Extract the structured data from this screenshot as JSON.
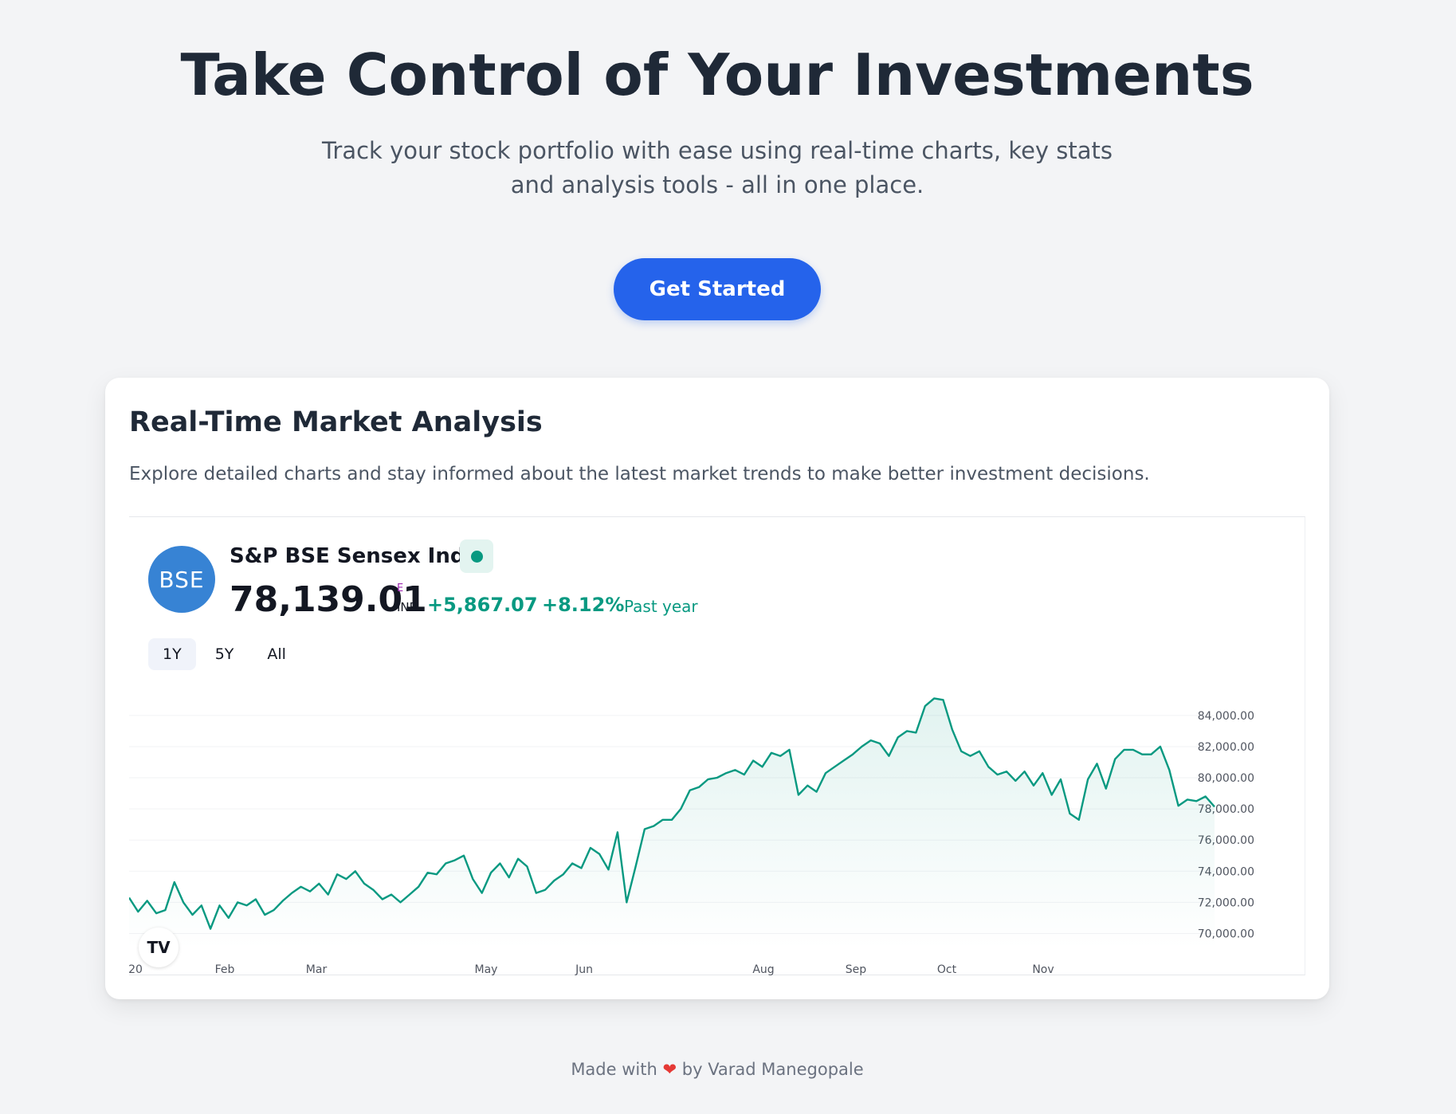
{
  "hero": {
    "title": "Take Control of Your Investments",
    "subtitle": "Track your stock portfolio with ease using real-time charts, key stats and analysis tools - all in one place.",
    "cta_label": "Get Started"
  },
  "card": {
    "title": "Real-Time Market Analysis",
    "description": "Explore detailed charts and stay informed about the latest market trends to make better investment decisions."
  },
  "widget": {
    "logo_text": "BSE",
    "symbol_name": "S&P BSE Sensex Index",
    "price": "78,139.01",
    "currency_flag": "E",
    "currency": "INR",
    "change": "+5,867.07",
    "change_pct": "+8.12%",
    "period": "Past year",
    "ranges": [
      "1Y",
      "5Y",
      "All"
    ],
    "active_range": "1Y",
    "tv_logo_text": "TV"
  },
  "colors": {
    "accent": "#2563eb",
    "line": "#089981",
    "brand_logo": "#3783d4"
  },
  "chart_data": {
    "type": "area",
    "x_ticks": [
      "20",
      "Feb",
      "Mar",
      "May",
      "Jun",
      "Aug",
      "Sep",
      "Oct",
      "Nov"
    ],
    "y_ticks": [
      "70,000.00",
      "72,000.00",
      "74,000.00",
      "76,000.00",
      "78,000.00",
      "80,000.00",
      "82,000.00",
      "84,000.00"
    ],
    "ylim": [
      69000,
      86500
    ],
    "grid": true,
    "series": [
      {
        "values": [
          72300,
          71400,
          72100,
          71300,
          71500,
          73300,
          72000,
          71200,
          71800,
          70300,
          71800,
          71000,
          72000,
          71800,
          72200,
          71200,
          71500,
          72100,
          72600,
          73000,
          72700,
          73200,
          72500,
          73800,
          73500,
          74000,
          73200,
          72800,
          72200,
          72500,
          72000,
          72500,
          73000,
          73900,
          73800,
          74500,
          74700,
          75000,
          73500,
          72600,
          73900,
          74500,
          73600,
          74800,
          74300,
          72600,
          72800,
          73400,
          73800,
          74500,
          74200,
          75500,
          75100,
          74100,
          76500,
          72000,
          74300,
          76700,
          76900,
          77300,
          77300,
          78000,
          79200,
          79400,
          79900,
          80000,
          80300,
          80500,
          80200,
          81100,
          80700,
          81600,
          81400,
          81800,
          78900,
          79500,
          79100,
          80300,
          80700,
          81100,
          81500,
          82000,
          82400,
          82200,
          81400,
          82600,
          83000,
          82900,
          84600,
          85100,
          85000,
          83100,
          81700,
          81400,
          81700,
          80700,
          80200,
          80400,
          79800,
          80400,
          79500,
          80300,
          78900,
          79900,
          77700,
          77300,
          79900,
          80900,
          79300,
          81200,
          81800,
          81800,
          81500,
          81500,
          82000,
          80500,
          78200,
          78600,
          78500,
          78800,
          78139
        ]
      }
    ]
  },
  "footer": {
    "prefix": "Made with",
    "heart": "❤",
    "suffix": "by Varad Manegopale"
  }
}
